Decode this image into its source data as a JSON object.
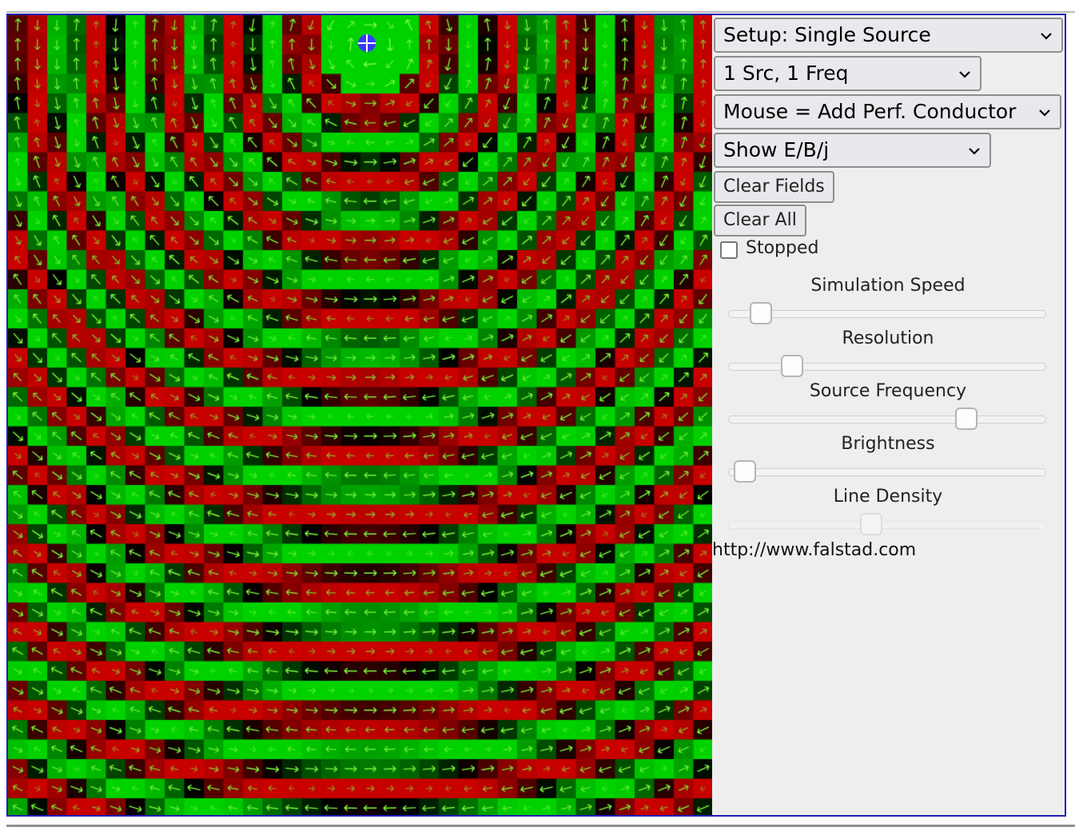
{
  "toolbar": {
    "setup_select": "Setup: Single Source",
    "source_select": "1 Src, 1 Freq",
    "mouse_select": "Mouse = Add Perf. Conductor",
    "show_select": "Show E/B/j",
    "clear_fields_label": "Clear Fields",
    "clear_all_label": "Clear All",
    "stopped_label": "Stopped",
    "stopped_checked": false
  },
  "sliders": [
    {
      "label": "Simulation Speed",
      "value": 0.1,
      "enabled": true
    },
    {
      "label": "Resolution",
      "value": 0.2,
      "enabled": true
    },
    {
      "label": "Source Frequency",
      "value": 0.75,
      "enabled": true
    },
    {
      "label": "Brightness",
      "value": 0.05,
      "enabled": true
    },
    {
      "label": "Line Density",
      "value": 0.45,
      "enabled": false
    }
  ],
  "footer": {
    "url": "http://www.falstad.com"
  },
  "colors": {
    "positive": "#ff0000",
    "negative": "#00ff00",
    "arrow": "#7dff3c",
    "source_marker": "#3a3aff",
    "border": "#1f1fb8"
  },
  "icons": {
    "dropdown": "chevron-down-icon",
    "source": "source-crosshair-icon"
  }
}
